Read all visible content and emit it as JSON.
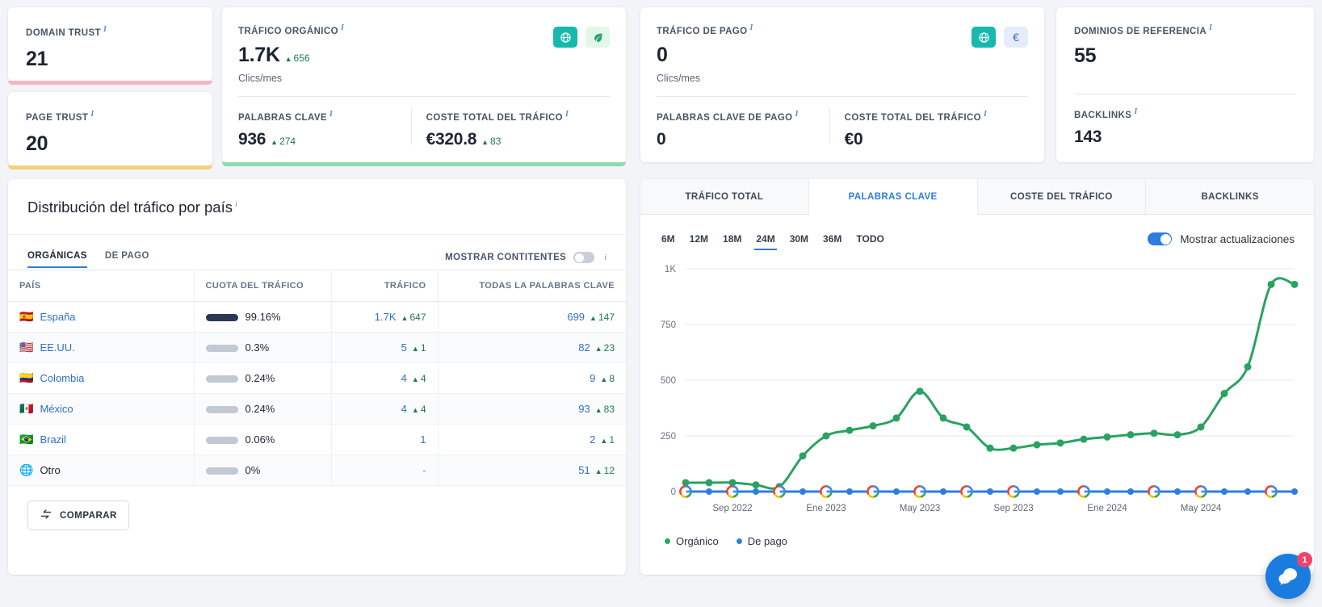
{
  "colors": {
    "organic": "#2aa262",
    "paid": "#2f7de0",
    "accent_blue": "#2b7de0",
    "teal": "#17b8ad",
    "pink_accent": "#f5b6c3",
    "yellow_accent": "#f2d17a",
    "green_accent": "#8fd9b0",
    "badge_red": "#f0426b"
  },
  "cards": {
    "domain_trust": {
      "label": "DOMAIN TRUST",
      "value": "21"
    },
    "page_trust": {
      "label": "PAGE TRUST",
      "value": "20"
    },
    "organic": {
      "label": "TRÁFICO ORGÁNICO",
      "value": "1.7K",
      "delta": "656",
      "sub": "Clics/mes",
      "icons": [
        "globe-icon",
        "leaf-icon"
      ],
      "keywords": {
        "label": "PALABRAS CLAVE",
        "value": "936",
        "delta": "274"
      },
      "cost": {
        "label": "COSTE TOTAL DEL TRÁFICO",
        "value": "€320.8",
        "delta": "83"
      }
    },
    "paid": {
      "label": "TRÁFICO DE PAGO",
      "value": "0",
      "sub": "Clics/mes",
      "icons": [
        "globe-icon",
        "euro-icon"
      ],
      "euro_symbol": "€",
      "keywords": {
        "label": "PALABRAS CLAVE DE PAGO",
        "value": "0"
      },
      "cost": {
        "label": "COSTE TOTAL DEL TRÁFICO",
        "value": "€0"
      }
    },
    "referring": {
      "label": "DOMINIOS DE REFERENCIA",
      "value": "55",
      "backlinks": {
        "label": "BACKLINKS",
        "value": "143"
      }
    }
  },
  "distribution": {
    "title": "Distribución del tráfico por país",
    "tabs": [
      {
        "label": "ORGÁNICAS",
        "active": true
      },
      {
        "label": "DE PAGO",
        "active": false
      }
    ],
    "continents_toggle": {
      "label": "MOSTRAR CONTITENTES",
      "on": false
    },
    "columns": [
      "PAÍS",
      "CUOTA DEL TRÁFICO",
      "TRÁFICO",
      "TODAS LA PALABRAS CLAVE"
    ],
    "rows": [
      {
        "flag": "🇪🇸",
        "country": "España",
        "share": "99.16%",
        "share_pct": 100,
        "traffic": "1.7K",
        "traffic_delta": "647",
        "keywords": "699",
        "keywords_delta": "147"
      },
      {
        "flag": "🇺🇸",
        "country": "EE.UU.",
        "share": "0.3%",
        "share_pct": 8,
        "traffic": "5",
        "traffic_delta": "1",
        "keywords": "82",
        "keywords_delta": "23"
      },
      {
        "flag": "🇨🇴",
        "country": "Colombia",
        "share": "0.24%",
        "share_pct": 8,
        "traffic": "4",
        "traffic_delta": "4",
        "keywords": "9",
        "keywords_delta": "8"
      },
      {
        "flag": "🇲🇽",
        "country": "México",
        "share": "0.24%",
        "share_pct": 8,
        "traffic": "4",
        "traffic_delta": "4",
        "keywords": "93",
        "keywords_delta": "83"
      },
      {
        "flag": "🇧🇷",
        "country": "Brazil",
        "share": "0.06%",
        "share_pct": 8,
        "traffic": "1",
        "traffic_delta": "",
        "keywords": "2",
        "keywords_delta": "1"
      },
      {
        "flag": "globe",
        "country": "Otro",
        "share": "0%",
        "share_pct": 8,
        "traffic": "-",
        "traffic_delta": "",
        "keywords": "51",
        "keywords_delta": "12"
      }
    ],
    "compare_button": "COMPARAR"
  },
  "panel": {
    "tabs": [
      {
        "label": "TRÁFICO TOTAL",
        "active": false
      },
      {
        "label": "PALABRAS CLAVE",
        "active": true
      },
      {
        "label": "COSTE DEL TRÁFICO",
        "active": false
      },
      {
        "label": "BACKLINKS",
        "active": false
      }
    ],
    "ranges": [
      {
        "label": "6M",
        "active": false
      },
      {
        "label": "12M",
        "active": false
      },
      {
        "label": "18M",
        "active": false
      },
      {
        "label": "24M",
        "active": true
      },
      {
        "label": "30M",
        "active": false
      },
      {
        "label": "36M",
        "active": false
      },
      {
        "label": "TODO",
        "active": false
      }
    ],
    "updates_toggle": {
      "label": "Mostrar actualizaciones",
      "on": true
    }
  },
  "chart_data": {
    "type": "line",
    "title": "",
    "xlabel": "",
    "ylabel": "",
    "ylim": [
      0,
      1000
    ],
    "yticks": [
      "0",
      "250",
      "500",
      "750",
      "1K"
    ],
    "ytick_values": [
      0,
      250,
      500,
      750,
      1000
    ],
    "grid": true,
    "legend_position": "bottom-left",
    "x": [
      "Jul 2022",
      "Ago 2022",
      "Sep 2022",
      "Oct 2022",
      "Nov 2022",
      "Dic 2022",
      "Ene 2023",
      "Feb 2023",
      "Mar 2023",
      "Abr 2023",
      "May 2023",
      "Jun 2023",
      "Jul 2023",
      "Ago 2023",
      "Sep 2023",
      "Oct 2023",
      "Nov 2023",
      "Dic 2023",
      "Ene 2024",
      "Feb 2024",
      "Mar 2024",
      "Abr 2024",
      "May 2024",
      "Jun 2024",
      "Jul 2024",
      "Ago 2024",
      "Sep 2024"
    ],
    "xtick_labels": [
      "Sep 2022",
      "Ene 2023",
      "May 2023",
      "Sep 2023",
      "Ene 2024",
      "May 2024"
    ],
    "xtick_indices": [
      2,
      6,
      10,
      14,
      18,
      22
    ],
    "series": [
      {
        "name": "Orgánico",
        "color": "#2aa262",
        "values": [
          40,
          40,
          40,
          30,
          22,
          160,
          250,
          275,
          295,
          330,
          450,
          330,
          290,
          195,
          195,
          210,
          218,
          235,
          245,
          255,
          262,
          255,
          290,
          440,
          560,
          930,
          930
        ]
      },
      {
        "name": "De pago",
        "color": "#2f7de0",
        "values": [
          0,
          0,
          0,
          0,
          0,
          0,
          0,
          0,
          0,
          0,
          0,
          0,
          0,
          0,
          0,
          0,
          0,
          0,
          0,
          0,
          0,
          0,
          0,
          0,
          0,
          0,
          0
        ]
      }
    ],
    "google_update_indices": [
      0,
      2,
      4,
      6,
      8,
      10,
      12,
      14,
      17,
      20,
      22,
      25
    ],
    "legend": [
      {
        "label": "Orgánico",
        "color": "#2aa262"
      },
      {
        "label": "De pago",
        "color": "#2f7de0"
      }
    ]
  },
  "chat": {
    "badge": "1",
    "icon": "chat-icon"
  }
}
